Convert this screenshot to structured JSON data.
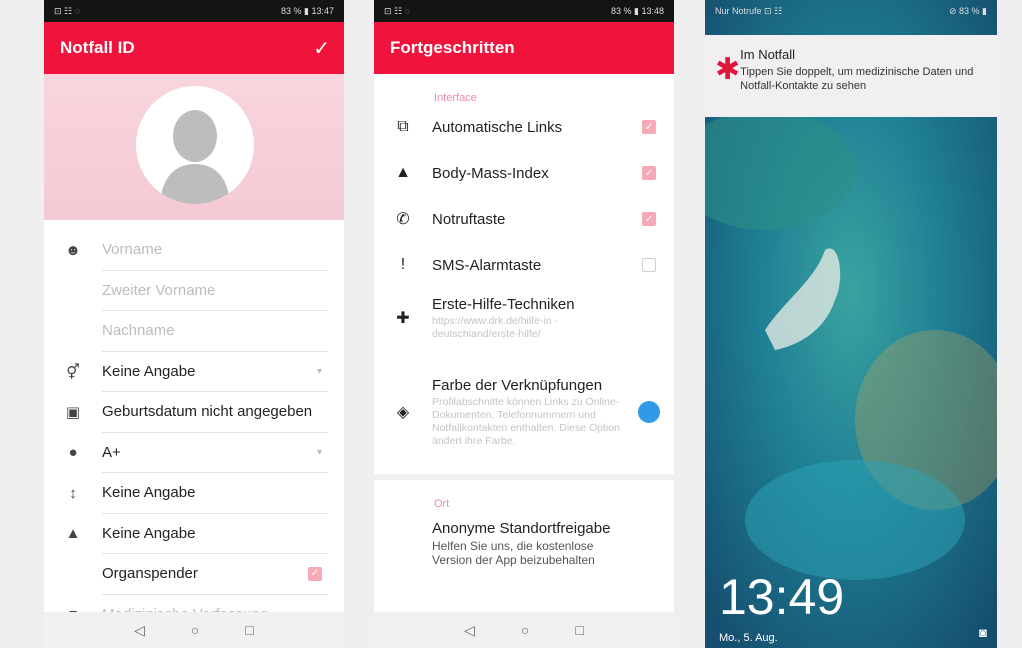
{
  "phone1": {
    "status": {
      "left": "⊡ ☷ ◌",
      "right": "83 % ▮ 13:47"
    },
    "title": "Notfall ID",
    "fields": [
      {
        "icon": "person-icon",
        "glyph": "☻",
        "label": "Vorname",
        "placeholder": true
      },
      {
        "icon": "",
        "glyph": "",
        "label": "Zweiter Vorname",
        "placeholder": true
      },
      {
        "icon": "",
        "glyph": "",
        "label": "Nachname",
        "placeholder": true
      },
      {
        "icon": "gender-icon",
        "glyph": "⚥",
        "label": "Keine Angabe",
        "dropdown": true
      },
      {
        "icon": "calendar-icon",
        "glyph": "▣",
        "label": "Geburtsdatum nicht angegeben"
      },
      {
        "icon": "blood-drop-icon",
        "glyph": "●",
        "label": "A+",
        "dropdown": true
      },
      {
        "icon": "height-icon",
        "glyph": "↕",
        "label": "Keine Angabe"
      },
      {
        "icon": "weight-icon",
        "glyph": "▲",
        "label": "Keine Angabe"
      },
      {
        "icon": "",
        "glyph": "",
        "label": "Organspender",
        "checkbox": true
      },
      {
        "icon": "medical-icon",
        "glyph": "■",
        "label": "Medizinische Verfassung",
        "placeholder": true
      }
    ]
  },
  "phone2": {
    "status": {
      "left": "⊡ ☷ ◌",
      "right": "83 % ▮ 13:48"
    },
    "title": "Fortgeschritten",
    "section1": "Interface",
    "items": [
      {
        "icon": "external-link-icon",
        "glyph": "⧉",
        "title": "Automatische Links",
        "sub": "",
        "check": true
      },
      {
        "icon": "weight-icon",
        "glyph": "▲",
        "title": "Body-Mass-Index",
        "sub": "",
        "check": true
      },
      {
        "icon": "phone-icon",
        "glyph": "✆",
        "title": "Notruftaste",
        "sub": "",
        "check": true
      },
      {
        "icon": "alert-message-icon",
        "glyph": "!",
        "title": "SMS-Alarmtaste",
        "sub": "",
        "check": false
      },
      {
        "icon": "first-aid-icon",
        "glyph": "✚",
        "title": "Erste-Hilfe-Techniken",
        "sub": "https://www.drk.de/hilfe-in -deutschland/erste-hilfe/",
        "check": null
      },
      {
        "icon": "paint-bucket-icon",
        "glyph": "◈",
        "title": "Farbe der Verknüpfungen",
        "sub": "Profilabschnitte können Links zu Online-Dokumenten, Telefonnummern und Notfallkontakten enthalten. Diese Option ändert ihre Farbe.",
        "color": "#2f9be8"
      }
    ],
    "section2": "Ort",
    "loc": {
      "title": "Anonyme Standortfreigabe",
      "sub": "Helfen Sie uns, die kostenlose Version der App beizubehalten"
    }
  },
  "phone3": {
    "status": {
      "left": "Nur Notrufe ⊡ ☷",
      "right": "⊘ 83 % ▮"
    },
    "notif_title": "Im Notfall",
    "notif_body": "Tippen Sie doppelt, um medizinische Daten und Notfall-Kontakte zu sehen",
    "time": "13:49",
    "date": "Mo., 5. Aug."
  },
  "nav": {
    "back": "◁",
    "home": "○",
    "recent": "□"
  },
  "colors": {
    "accent": "#f0133b",
    "check_on": "#f7a9b7",
    "link_color": "#2f9be8",
    "section": "#f08aa0"
  }
}
